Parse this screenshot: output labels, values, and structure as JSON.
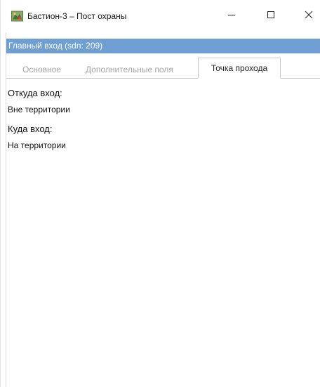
{
  "window": {
    "title": "Бастион-3 – Пост охраны",
    "icon": "app-icon",
    "controls": {
      "minimize_icon": "minimize-icon",
      "maximize_icon": "maximize-icon",
      "close_icon": "close-icon"
    }
  },
  "infobar": {
    "text": "Главный вход (sdn: 209)",
    "color": "#6f9fd2"
  },
  "tabs": [
    {
      "label": "Основное",
      "active": false
    },
    {
      "label": "Дополнительные поля",
      "active": false
    },
    {
      "label": "Точка прохода",
      "active": true
    }
  ],
  "passage_point": {
    "from_label": "Откуда вход:",
    "from_value": "Вне территории",
    "to_label": "Куда вход:",
    "to_value": "На территории"
  }
}
